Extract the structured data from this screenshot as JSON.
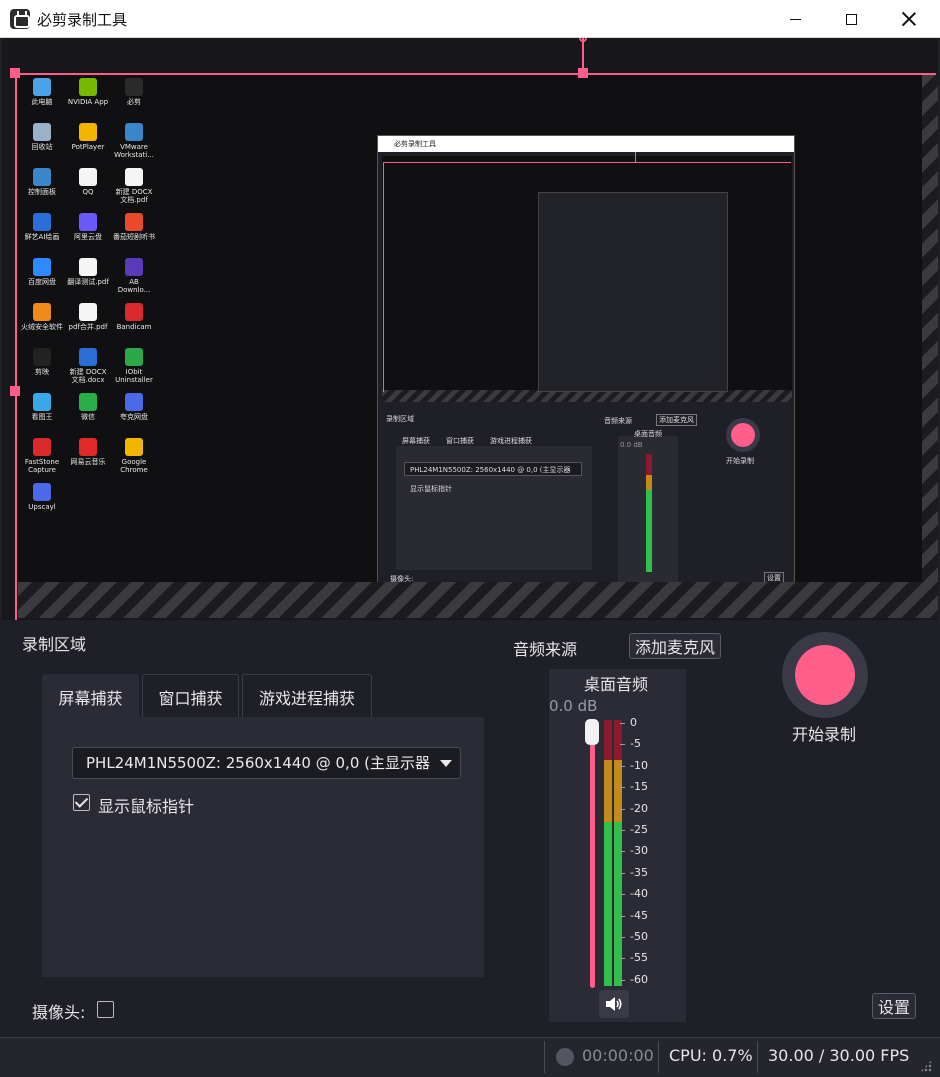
{
  "window": {
    "title": "必剪录制工具"
  },
  "desktop_icons": [
    {
      "label": "此电脑",
      "color": "#4aa3e8"
    },
    {
      "label": "NVIDIA App",
      "color": "#76b900"
    },
    {
      "label": "必剪",
      "color": "#2b2b2b"
    },
    {
      "label": "回收站",
      "color": "#9ab2c8"
    },
    {
      "label": "PotPlayer",
      "color": "#f2b600"
    },
    {
      "label": "VMware Workstati...",
      "color": "#3a86c8"
    },
    {
      "label": "控制面板",
      "color": "#3a86c8"
    },
    {
      "label": "QQ",
      "color": "#f5f5f5"
    },
    {
      "label": "新建 DOCX 文档.pdf",
      "color": "#f5f5f5"
    },
    {
      "label": "鲜艺AI绘画",
      "color": "#2b6ed8"
    },
    {
      "label": "阿里云盘",
      "color": "#6a5af9"
    },
    {
      "label": "番茄短剧听书",
      "color": "#e84a2a"
    },
    {
      "label": "百度网盘",
      "color": "#2e8bff"
    },
    {
      "label": "翻译测试.pdf",
      "color": "#f5f5f5"
    },
    {
      "label": "AB Downlo...",
      "color": "#5a3ab8"
    },
    {
      "label": "火绒安全软件",
      "color": "#f08a1a"
    },
    {
      "label": "pdf合并.pdf",
      "color": "#f5f5f5"
    },
    {
      "label": "Bandicam",
      "color": "#d82a2a"
    },
    {
      "label": "剪映",
      "color": "#222222"
    },
    {
      "label": "新建 DOCX 文档.docx",
      "color": "#2b6ed8"
    },
    {
      "label": "IObit Uninstaller",
      "color": "#2aa84a"
    },
    {
      "label": "看图王",
      "color": "#3aa8e8"
    },
    {
      "label": "微信",
      "color": "#2aae4a"
    },
    {
      "label": "夸克网盘",
      "color": "#4a6ae8"
    },
    {
      "label": "FastStone Capture",
      "color": "#d82a2a"
    },
    {
      "label": "网易云音乐",
      "color": "#e02a2a"
    },
    {
      "label": "Google Chrome",
      "color": "#f2b600"
    },
    {
      "label": "Upscayl",
      "color": "#4a6ae8"
    }
  ],
  "nested_preview": {
    "title": "必剪录制工具",
    "region_label": "录制区域",
    "audio_label": "音频来源",
    "add_mic": "添加麦克风",
    "tabs": [
      "屏幕捕获",
      "窗口捕获",
      "游戏进程捕获"
    ],
    "combo": "PHL24M1N5500Z: 2560x1440 @ 0,0 (主显示器",
    "cursor": "显示鼠标指针",
    "desk_audio": "桌面音频",
    "db": "0.0 dB",
    "start": "开始录制",
    "settings": "设置",
    "camera": "摄像头:"
  },
  "controls": {
    "region_label": "录制区域",
    "tabs": [
      {
        "label": "屏幕捕获",
        "active": true
      },
      {
        "label": "窗口捕获",
        "active": false
      },
      {
        "label": "游戏进程捕获",
        "active": false
      }
    ],
    "display_select": "PHL24M1N5500Z: 2560x1440 @ 0,0 (主显示器",
    "show_cursor_label": "显示鼠标指针",
    "show_cursor_checked": true,
    "camera_label": "摄像头:",
    "camera_checked": false
  },
  "audio": {
    "source_label": "音频来源",
    "add_mic_label": "添加麦克风",
    "channel_label": "桌面音频",
    "volume_db": "0.0 dB",
    "scale": [
      "0",
      "-5",
      "-10",
      "-15",
      "-20",
      "-25",
      "-30",
      "-35",
      "-40",
      "-45",
      "-50",
      "-55",
      "-60"
    ]
  },
  "record": {
    "start_label": "开始录制",
    "settings_label": "设置"
  },
  "status": {
    "timer": "00:00:00",
    "cpu": "CPU: 0.7%",
    "fps": "30.00 / 30.00 FPS"
  },
  "colors": {
    "accent": "#ff5d8a",
    "meter_red": "#8b1a2e",
    "meter_yellow": "#c58a1a",
    "meter_green": "#2fbf4a"
  }
}
